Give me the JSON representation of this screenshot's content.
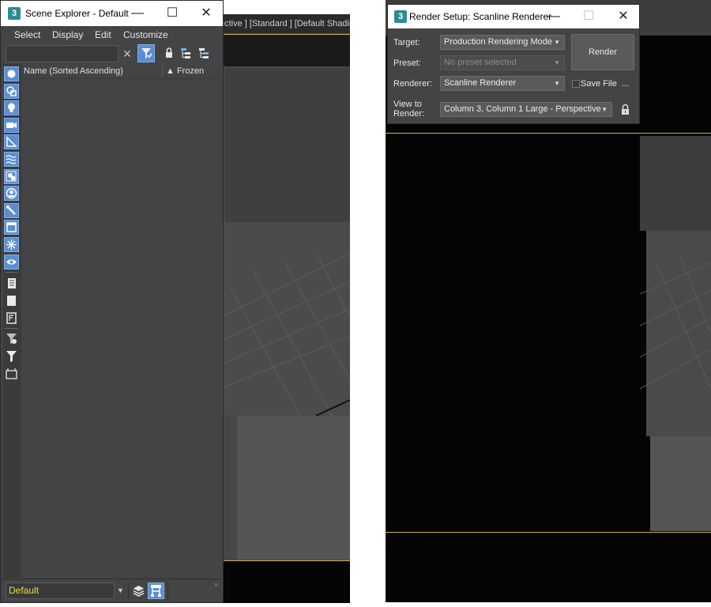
{
  "scene_explorer": {
    "title": "Scene Explorer - Default",
    "app_icon_glyph": "3",
    "window_buttons": {
      "minimize": "—",
      "maximize": "☐",
      "close": "✕"
    },
    "menu": [
      "Select",
      "Display",
      "Edit",
      "Customize"
    ],
    "search": {
      "value": "",
      "placeholder": ""
    },
    "columns": {
      "name": "Name (Sorted Ascending)",
      "frozen": "▲ Frozen"
    },
    "side_toolbar_icons": [
      "geometry-icon",
      "shapes-icon",
      "lights-icon",
      "cameras-icon",
      "helpers-icon",
      "space-warps-icon",
      "groups-icon",
      "xrefs-icon",
      "bones-icon",
      "containers-icon",
      "frozen-icon",
      "hidden-icon",
      "display-all-icon",
      "display-none-icon",
      "invert-display-icon",
      "find-using-filter-icon",
      "filter-icon",
      "container-outline-icon"
    ],
    "layer": {
      "value": "Default"
    },
    "accent_color": "#5b8ed1",
    "layer_text_color": "#f3d648"
  },
  "viewport_left": {
    "label": "ective ] [Standard ] [Default Shadin"
  },
  "render_setup": {
    "title": "Render Setup: Scanline Renderer",
    "app_icon_glyph": "3",
    "window_buttons": {
      "minimize": "—",
      "maximize": "☐",
      "close": "✕"
    },
    "target": {
      "label": "Target:",
      "value": "Production Rendering Mode"
    },
    "preset": {
      "label": "Preset:",
      "value": "No preset selected"
    },
    "renderer": {
      "label": "Renderer:",
      "value": "Scanline Renderer"
    },
    "save_file": {
      "label": "Save File",
      "checked": false
    },
    "more_label": "...",
    "view_to_render": {
      "label_line1": "View to",
      "label_line2": "Render:",
      "value": "Column 3, Column 1 Large - Perspective"
    },
    "render_button": "Render",
    "dropdown_arrow": "▼"
  }
}
